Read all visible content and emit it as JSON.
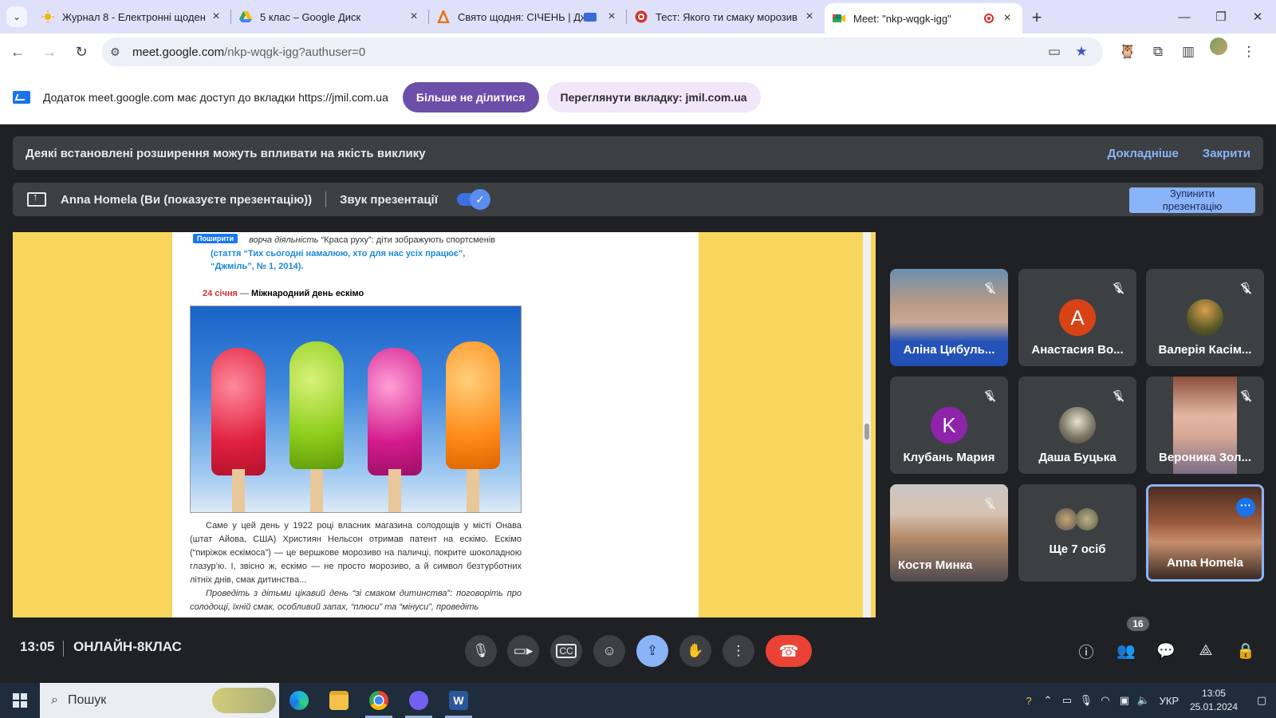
{
  "browser": {
    "tabs": [
      {
        "title": "Журнал 8 - Електронні щоден",
        "favicon": "sun-icon",
        "color": "#f5b400"
      },
      {
        "title": "5 клас – Google Диск",
        "favicon": "drive-icon",
        "color": "#34a853"
      },
      {
        "title": "Свято щодня: СІЧЕНЬ | Дж",
        "favicon": "jmil-icon",
        "color": "#e8710a"
      },
      {
        "title": "Тест: Якого ти смаку морозив",
        "favicon": "quiz-icon",
        "color": "#d93025"
      },
      {
        "title": "Meet: \"nkp-wqgk-igg\"",
        "favicon": "meet-icon",
        "color": "#00897b"
      }
    ],
    "url_main": "meet.google.com",
    "url_rest": "/nkp-wqgk-igg?authuser=0"
  },
  "share_banner": {
    "message": "Додаток meet.google.com має доступ до вкладки https://jmil.com.ua",
    "stop_label": "Більше не ділитися",
    "view_label": "Переглянути вкладку: jmil.com.ua"
  },
  "ext_warning": {
    "text": "Деякі встановлені розширення можуть впливати на якість виклику",
    "more": "Докладніше",
    "close": "Закрити"
  },
  "presenting": {
    "who": "Anna Homela (Ви (показуєте презентацію))",
    "sound": "Звук презентації",
    "sound_on": true,
    "stop_line1": "Зупинити",
    "stop_line2": "презентацію"
  },
  "document": {
    "share_badge": "Поширити",
    "line1_it": "ворча діяльність",
    "line1_rest": " “Краса руху”: діти зображують спортсменів",
    "line2": "(стаття “Тих сьогодні намалюю, хто для нас усіх працює”,",
    "line3": "“Джміль”, № 1, 2014).",
    "date": "24 січня",
    "dash": " — ",
    "heading": "Міжнародний день ескімо",
    "para1": "Саме у цей день у 1922 році власник магазина солодощів у місті Онава (штат Айова, США) Християн Нельсон отримав патент на ескімо. Ескімо (“пиріжок ескімоса”) — це вершкове морозиво на паличці, покрите шоколадною глазур’ю. І, звісно ж, ескімо — не просто морозиво, а й символ безтурботних літніх днів, смак дитинства...",
    "para2": "Проведіть з дітьми цікавий день “зі смаком дитинства”: поговоріть про солодощі, їхній смак, особливий запах, “плюси” та “мінуси”, проведіть"
  },
  "participants": [
    {
      "name": "Аліна Цибуль...",
      "kind": "video",
      "muted": true
    },
    {
      "name": "Анастасия Во...",
      "kind": "letter",
      "letter": "A",
      "color": "#d84315",
      "muted": true
    },
    {
      "name": "Валерія Касім...",
      "kind": "photo",
      "muted": true
    },
    {
      "name": "Клубань Мария",
      "kind": "letter",
      "letter": "K",
      "color": "#8e24aa",
      "muted": true
    },
    {
      "name": "Даша Буцька",
      "kind": "photo",
      "muted": true
    },
    {
      "name": "Вероника Зол...",
      "kind": "video",
      "muted": true
    },
    {
      "name": "Костя Минка",
      "kind": "video",
      "muted": true
    },
    {
      "name": "Ще 7 осіб",
      "kind": "more",
      "muted": false
    },
    {
      "name": "Anna Homela",
      "kind": "self",
      "muted": false
    }
  ],
  "controls": {
    "time": "13:05",
    "room": "ОНЛАЙН-8КЛАС",
    "people_count": "16"
  },
  "taskbar": {
    "search": "Пошук",
    "lang": "УКР",
    "time": "13:05",
    "date": "25.01.2024"
  }
}
